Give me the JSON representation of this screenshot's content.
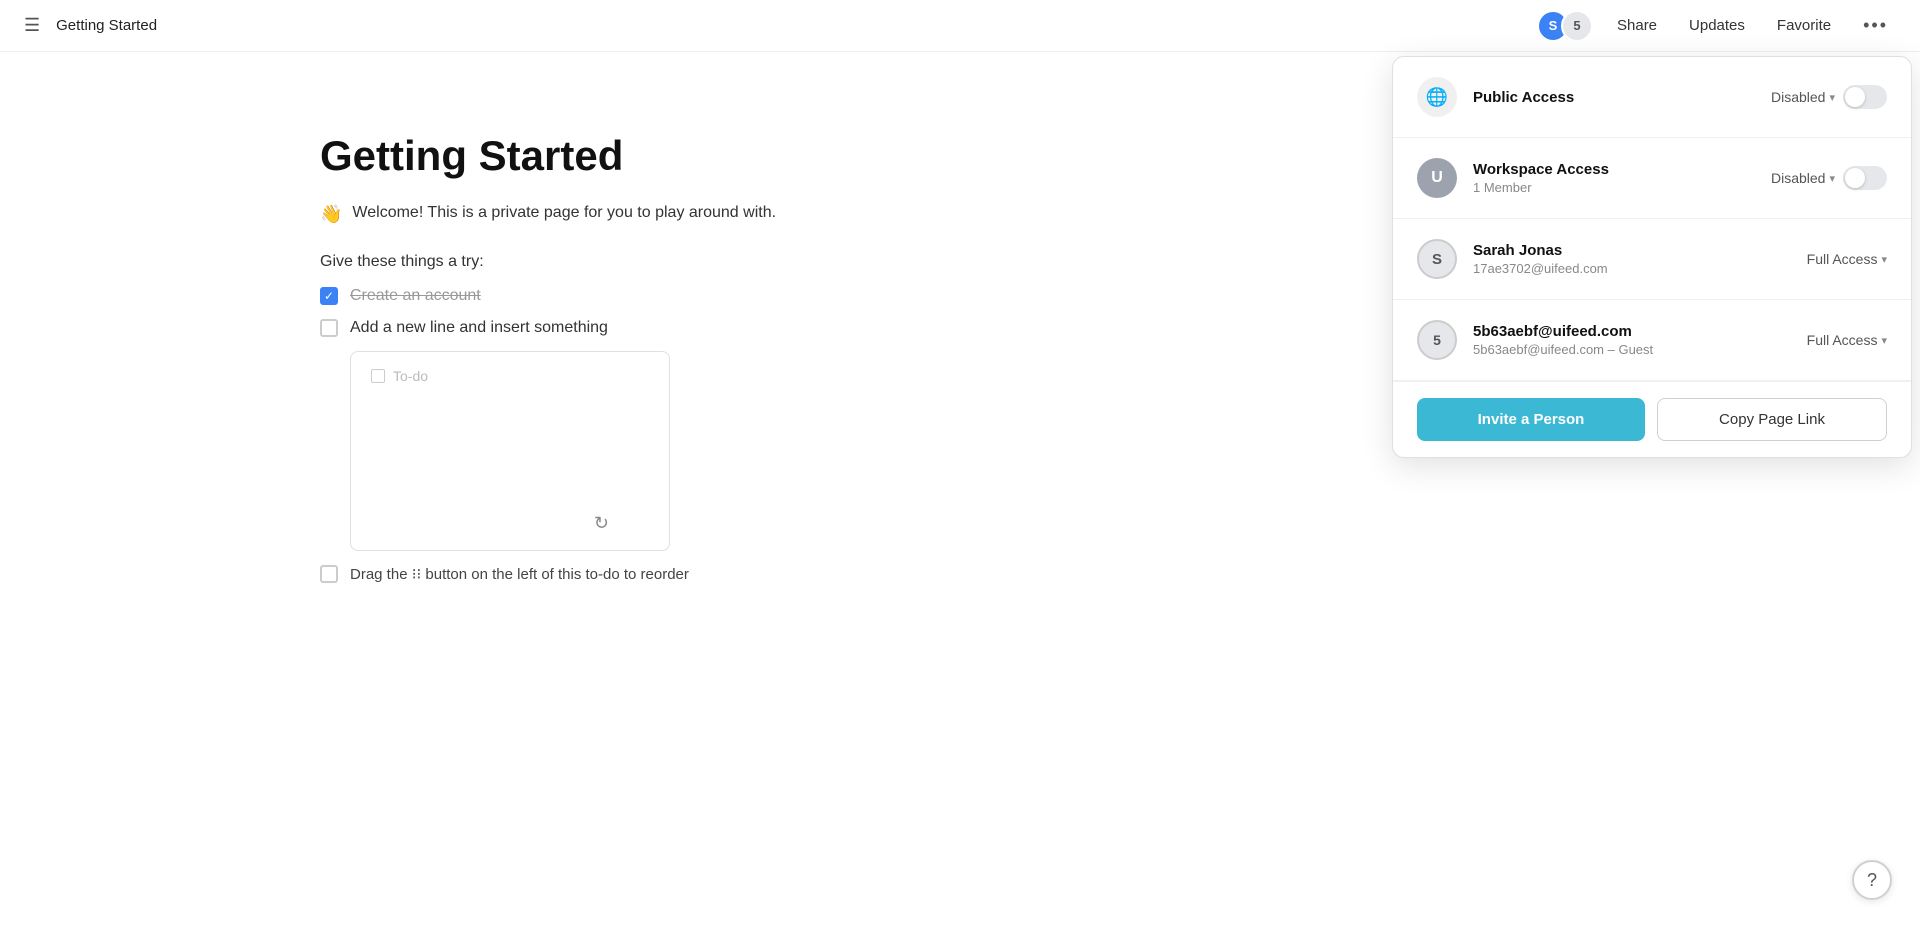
{
  "topbar": {
    "hamburger": "☰",
    "page_title": "Getting Started",
    "avatar_letter": "S",
    "avatar_count": "5",
    "share_label": "Share",
    "updates_label": "Updates",
    "favorite_label": "Favorite",
    "more_label": "•••"
  },
  "doc": {
    "title": "Getting Started",
    "welcome_emoji": "👋",
    "welcome_text": "Welcome! This is a private page for you to play around with.",
    "give_things": "Give these things a try:",
    "todo_items": [
      {
        "id": 1,
        "text": "Create an account",
        "done": true
      },
      {
        "id": 2,
        "text": "Add a new line and insert something",
        "done": false
      }
    ],
    "todo_placeholder": "To-do",
    "drag_hint": "Drag the ⁝⁝ button on the left of this to-do to reorder"
  },
  "share_panel": {
    "public_access": {
      "icon": "🌐",
      "title": "Public Access",
      "status": "Disabled",
      "toggle_on": false
    },
    "workspace_access": {
      "icon": "U",
      "title": "Workspace Access",
      "subtitle": "1 Member",
      "status": "Disabled",
      "toggle_on": false
    },
    "member1": {
      "icon": "S",
      "name": "Sarah Jonas",
      "email": "17ae3702@uifeed.com",
      "access": "Full Access"
    },
    "member2": {
      "icon": "5",
      "name": "5b63aebf@uifeed.com",
      "email_sub": "5b63aebf@uifeed.com – Guest",
      "access": "Full Access"
    },
    "invite_label": "Invite a Person",
    "copy_label": "Copy Page Link"
  },
  "help": {
    "icon": "?"
  }
}
